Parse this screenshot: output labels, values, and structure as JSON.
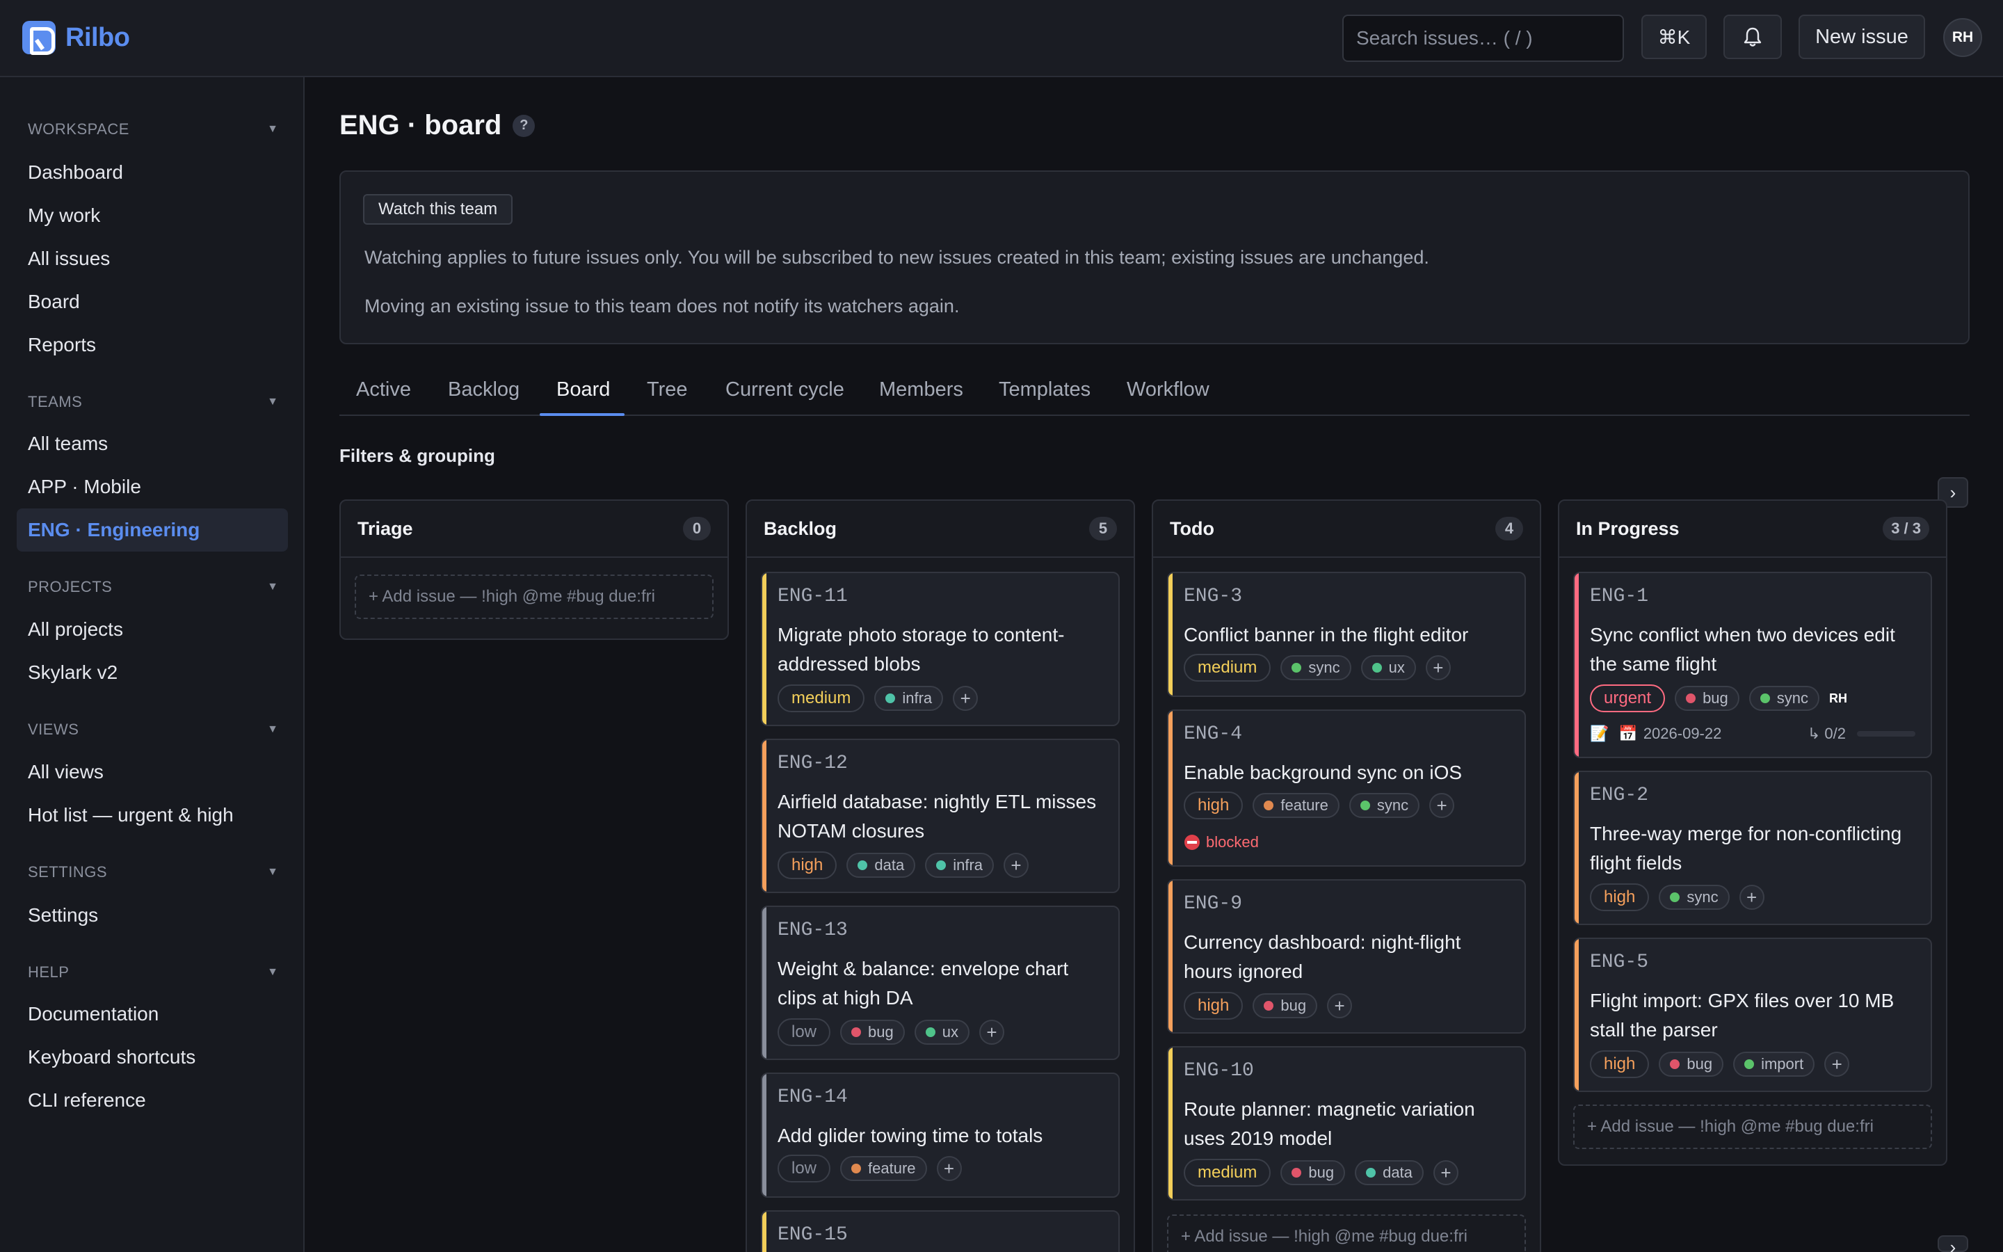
{
  "app": {
    "name": "Rilbo"
  },
  "header": {
    "search_placeholder": "Search issues…  ( / )",
    "cmdk_label": "⌘K",
    "bell_icon": "bell-icon",
    "new_issue_label": "New issue",
    "avatar_initials": "RH"
  },
  "sidebar": {
    "workspace": {
      "label": "WORKSPACE",
      "items": [
        "Dashboard",
        "My work",
        "All issues",
        "Board",
        "Reports"
      ]
    },
    "teams": {
      "label": "TEAMS",
      "items": [
        "All teams",
        "APP · Mobile",
        "ENG · Engineering"
      ],
      "active": "ENG · Engineering"
    },
    "projects": {
      "label": "PROJECTS",
      "items": [
        "All projects",
        "Skylark v2"
      ]
    },
    "views": {
      "label": "VIEWS",
      "items": [
        "All views",
        "Hot list — urgent & high"
      ]
    },
    "settings": {
      "label": "SETTINGS",
      "items": [
        "Settings"
      ]
    },
    "help": {
      "label": "HELP",
      "items": [
        "Documentation",
        "Keyboard shortcuts",
        "CLI reference"
      ]
    }
  },
  "main": {
    "title": "ENG · board",
    "help_glyph": "?",
    "notice": {
      "watch_label": "Watch this team",
      "line1": "Watching applies to future issues only. You will be subscribed to new issues created in this team; existing issues are unchanged.",
      "line2": "Moving an existing issue to this team does not notify its watchers again."
    },
    "tabs": [
      "Active",
      "Backlog",
      "Board",
      "Tree",
      "Current cycle",
      "Members",
      "Templates",
      "Workflow"
    ],
    "active_tab": "Board",
    "filters_label": "Filters & grouping",
    "add_issue_placeholder": "+ Add issue — !high @me #bug due:fri"
  },
  "colors": {
    "accent": "#5b8def",
    "urgent": "#ff6b81",
    "high": "#f5a05c",
    "medium": "#f3cf5a",
    "low": "#8a8f9c",
    "tag_bug": "#e0556a",
    "tag_infra": "#4fc3a8",
    "tag_ux": "#4fc38a",
    "tag_data": "#4fc3a8",
    "tag_feature": "#e0894f",
    "tag_sync": "#5bc36a",
    "tag_import": "#5bc36a"
  },
  "board": {
    "columns": [
      {
        "title": "Triage",
        "count": "0",
        "cards": []
      },
      {
        "title": "Backlog",
        "count": "5",
        "cards": [
          {
            "id": "ENG-11",
            "title": "Migrate photo storage to content-addressed blobs",
            "priority": "medium",
            "tags": [
              "infra"
            ]
          },
          {
            "id": "ENG-12",
            "title": "Airfield database: nightly ETL misses NOTAM closures",
            "priority": "high",
            "tags": [
              "data",
              "infra"
            ]
          },
          {
            "id": "ENG-13",
            "title": "Weight & balance: envelope chart clips at high DA",
            "priority": "low",
            "tags": [
              "bug",
              "ux"
            ]
          },
          {
            "id": "ENG-14",
            "title": "Add glider towing time to totals",
            "priority": "low",
            "tags": [
              "feature"
            ]
          },
          {
            "id": "ENG-15"
          }
        ]
      },
      {
        "title": "Todo",
        "count": "4",
        "cards": [
          {
            "id": "ENG-3",
            "title": "Conflict banner in the flight editor",
            "priority": "medium",
            "tags": [
              "sync",
              "ux"
            ]
          },
          {
            "id": "ENG-4",
            "title": "Enable background sync on iOS",
            "priority": "high",
            "tags": [
              "feature",
              "sync"
            ],
            "status": "blocked"
          },
          {
            "id": "ENG-9",
            "title": "Currency dashboard: night-flight hours ignored",
            "priority": "high",
            "tags": [
              "bug"
            ]
          },
          {
            "id": "ENG-10",
            "title": "Route planner: magnetic variation uses 2019 model",
            "priority": "medium",
            "tags": [
              "bug",
              "data"
            ]
          }
        ]
      },
      {
        "title": "In Progress",
        "count": "3 / 3",
        "cards": [
          {
            "id": "ENG-1",
            "title": "Sync conflict when two devices edit the same flight",
            "priority": "urgent",
            "tags": [
              "bug",
              "sync"
            ],
            "assignee": "RH",
            "note_icon": "📝",
            "calendar_icon": "📅",
            "due": "2026-09-22",
            "subtasks": "↳ 0/2",
            "progress": 0
          },
          {
            "id": "ENG-2",
            "title": "Three-way merge for non-conflicting flight fields",
            "priority": "high",
            "tags": [
              "sync"
            ]
          },
          {
            "id": "ENG-5",
            "title": "Flight import: GPX files over 10 MB stall the parser",
            "priority": "high",
            "tags": [
              "bug",
              "import"
            ]
          }
        ]
      }
    ]
  }
}
